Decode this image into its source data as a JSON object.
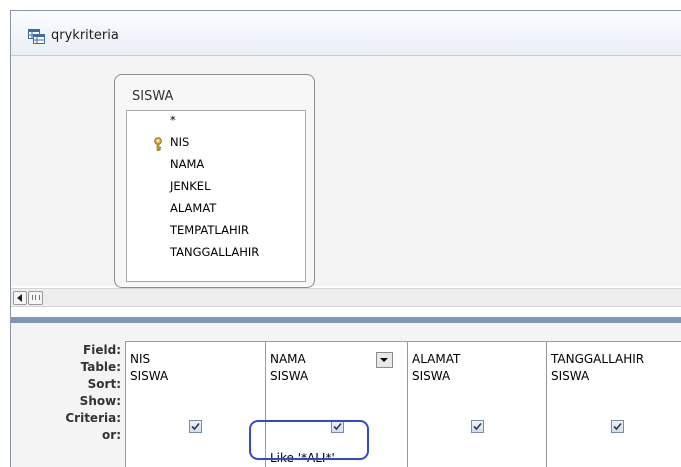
{
  "window": {
    "title": "qrykriteria"
  },
  "field_list": {
    "table_name": "SISWA",
    "fields": [
      "*",
      "NIS",
      "NAMA",
      "JENKEL",
      "ALAMAT",
      "TEMPATLAHIR",
      "TANGGALLAHIR"
    ],
    "primary_key": "NIS"
  },
  "grid": {
    "row_labels": [
      "Field:",
      "Table:",
      "Sort:",
      "Show:",
      "Criteria:",
      "or:"
    ],
    "columns": [
      {
        "field": "NIS",
        "table": "SISWA",
        "sort": "",
        "show": true,
        "criteria": "",
        "or": ""
      },
      {
        "field": "NAMA",
        "table": "SISWA",
        "sort": "",
        "show": true,
        "criteria": "Like '*ALI*'",
        "or": ""
      },
      {
        "field": "ALAMAT",
        "table": "SISWA",
        "sort": "",
        "show": true,
        "criteria": "",
        "or": ""
      },
      {
        "field": "TANGGALLAHIR",
        "table": "SISWA",
        "sort": "",
        "show": true,
        "criteria": "",
        "or": ""
      }
    ]
  },
  "colors": {
    "highlight_ring": "#3548d4",
    "splitter": "#7e97b6"
  },
  "icons": [
    "query-icon",
    "primary-key-icon",
    "dropdown-arrow-icon",
    "checkbox-checked-icon",
    "scroll-left-icon"
  ]
}
